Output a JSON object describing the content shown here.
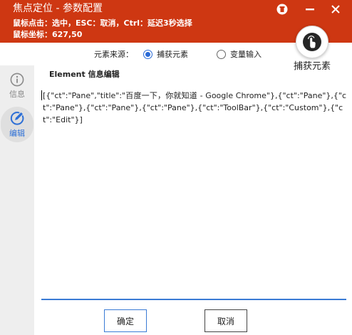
{
  "window": {
    "title": "焦点定位 - 参数配置",
    "hint_line": "鼠标点击：选中，ESC：取消，Ctrl：延迟3秒选择",
    "mouse_coords": "鼠标坐标：627,50"
  },
  "capture": {
    "label": "捕获元素"
  },
  "source": {
    "label": "元素来源：",
    "options": [
      {
        "label": "捕获元素",
        "checked": true
      },
      {
        "label": "变量输入",
        "checked": false
      }
    ]
  },
  "sidebar": {
    "items": [
      {
        "label": "信息",
        "icon": "info-icon",
        "active": false
      },
      {
        "label": "编辑",
        "icon": "edit-icon",
        "active": true
      }
    ]
  },
  "editor": {
    "title": "Element 信息编辑",
    "content": "[{\"ct\":\"Pane\",\"title\":\"百度一下，你就知道 - Google Chrome\"},{\"ct\":\"Pane\"},{\"ct\":\"Pane\"},{\"ct\":\"Pane\"},{\"ct\":\"Pane\"},{\"ct\":\"ToolBar\"},{\"ct\":\"Custom\"},{\"ct\":\"Edit\"}]"
  },
  "buttons": {
    "ok": "确定",
    "cancel": "取消"
  },
  "colors": {
    "header": "#ce3712",
    "accent": "#2a6ad6"
  }
}
